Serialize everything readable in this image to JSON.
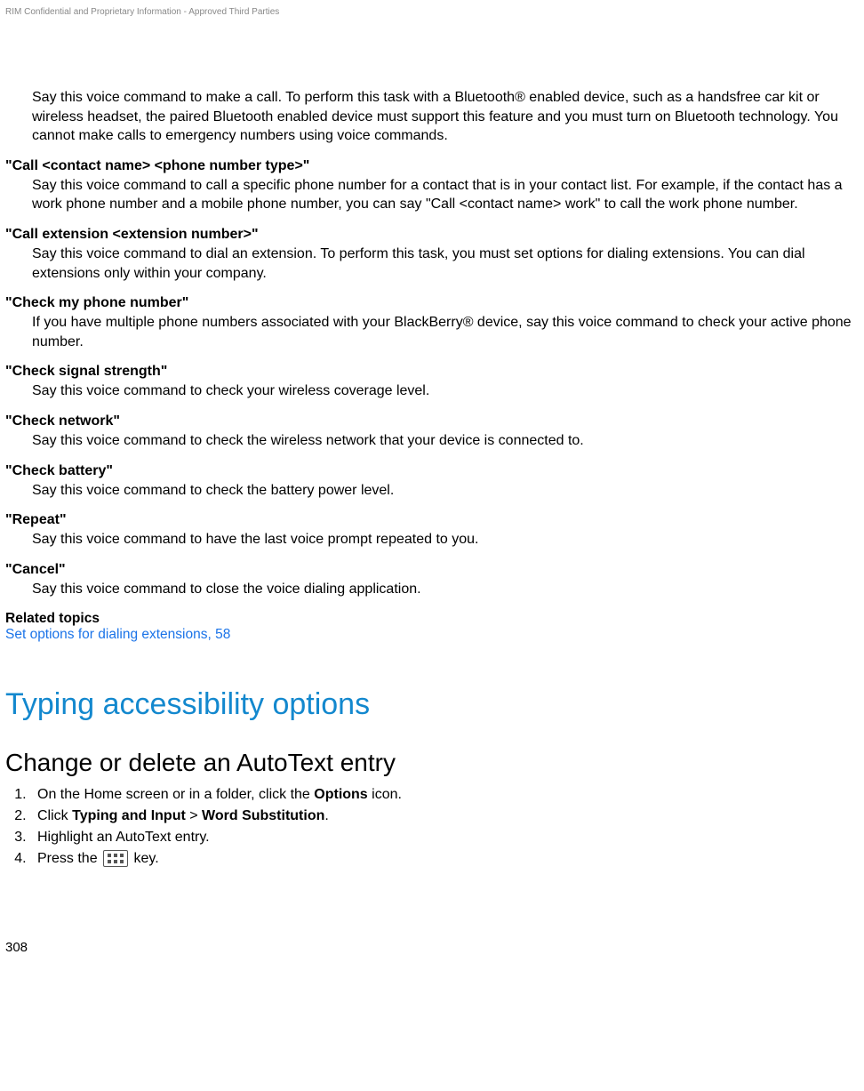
{
  "header_note": "RIM Confidential and Proprietary Information - Approved Third Parties",
  "commands": [
    {
      "term": null,
      "desc": "Say this voice command to make a call. To perform this task with a Bluetooth® enabled device, such as a handsfree car kit or wireless headset, the paired Bluetooth enabled device must support this feature and you must turn on Bluetooth technology. You cannot make calls to emergency numbers using voice commands."
    },
    {
      "term": "\"Call <contact name> <phone number type>\"",
      "desc": "Say this voice command to call a specific phone number for a contact that is in your contact list. For example, if the contact has a work phone number and a mobile phone number, you can say \"Call <contact name> work\" to call the work phone number."
    },
    {
      "term": "\"Call extension <extension number>\"",
      "desc": "Say this voice command to dial an extension. To perform this task, you must set options for dialing extensions. You can dial extensions only within your company."
    },
    {
      "term": "\"Check my phone number\"",
      "desc": "If you have multiple phone numbers associated with your BlackBerry® device, say this voice command to check your active phone number."
    },
    {
      "term": "\"Check signal strength\"",
      "desc": "Say this voice command to check your wireless coverage level."
    },
    {
      "term": "\"Check network\"",
      "desc": "Say this voice command to check the wireless network that your device is connected to."
    },
    {
      "term": "\"Check battery\"",
      "desc": "Say this voice command to check the battery power level."
    },
    {
      "term": "\"Repeat\"",
      "desc": "Say this voice command to have the last voice prompt repeated to you."
    },
    {
      "term": "\"Cancel\"",
      "desc": "Say this voice command to close the voice dialing application."
    }
  ],
  "related_label": "Related topics",
  "related_link": "Set options for dialing extensions, 58",
  "h2": "Typing accessibility options",
  "h3": "Change or delete an AutoText entry",
  "steps": {
    "s1_pre": "On the Home screen or in a folder, click the ",
    "s1_bold": "Options",
    "s1_post": " icon.",
    "s2_pre": "Click ",
    "s2_b1": "Typing and Input",
    "s2_sep": " > ",
    "s2_b2": "Word Substitution",
    "s2_post": ".",
    "s3": "Highlight an AutoText entry.",
    "s4_pre": "Press the ",
    "s4_post": " key."
  },
  "page_number": "308"
}
